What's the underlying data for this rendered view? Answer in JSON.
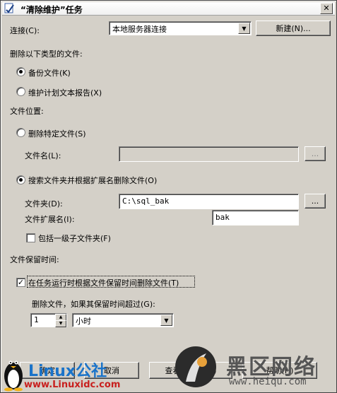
{
  "window": {
    "title": "“清除维护”任务"
  },
  "connection": {
    "label": "连接(C):",
    "value": "本地服务器连接",
    "new_button": "新建(N)..."
  },
  "delete_types": {
    "heading": "删除以下类型的文件:",
    "backup_files": "备份文件(K)",
    "maintenance_reports": "维护计划文本报告(X)"
  },
  "file_location": {
    "heading": "文件位置:",
    "delete_specific": "删除特定文件(S)",
    "filename_label": "文件名(L):",
    "filename_value": "",
    "browse1": "...",
    "search_folder": "搜索文件夹并根据扩展名删除文件(O)",
    "folder_label": "文件夹(D):",
    "folder_value": "C:\\sql_bak",
    "browse2": "...",
    "ext_label": "文件扩展名(I):",
    "ext_value": "bak",
    "include_subfolders": "包括一级子文件夹(F)"
  },
  "retention": {
    "heading": "文件保留时间:",
    "delete_on_run": "在任务运行时根据文件保留时间删除文件(T)",
    "older_than_label": "删除文件，如果其保留时间超过(G):",
    "amount": "1",
    "unit": "小时"
  },
  "buttons": {
    "ok": "确定",
    "cancel": "取消",
    "view_tsql": "查看 T-SQL(V)",
    "help": "帮助(H)"
  },
  "watermarks": {
    "left_brand": "Linux公社",
    "left_url": "www.Linuxidc.com",
    "right_brand": "黑区网络",
    "right_url": "www.heiqu.com"
  },
  "colors": {
    "dialog_bg": "#d4d0c8",
    "watermark_blue": "#1a73c9",
    "watermark_red": "#c8201e"
  }
}
